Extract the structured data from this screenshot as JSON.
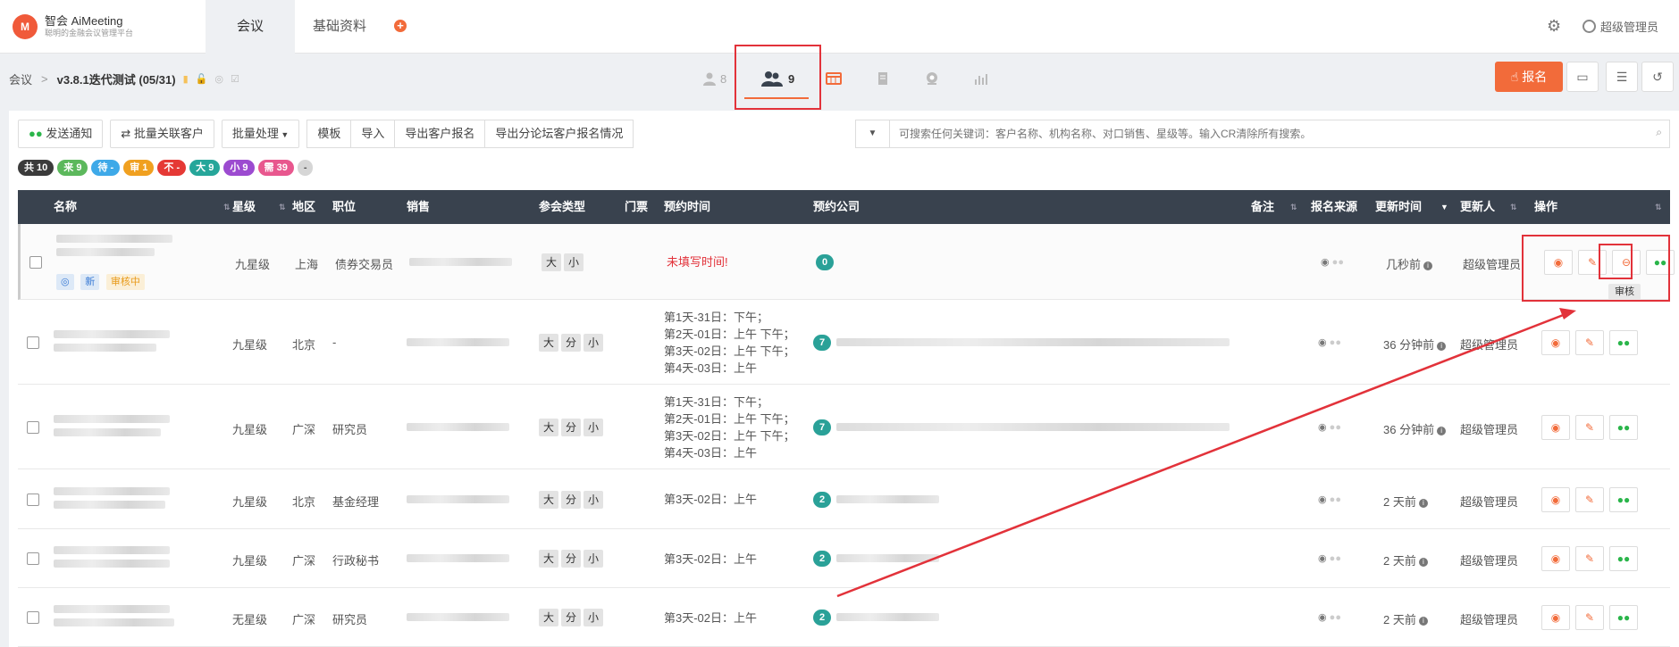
{
  "app": {
    "logo_mark": "M",
    "logo_title": "智会 AiMeeting",
    "logo_sub": "聪明的金融会议管理平台"
  },
  "nav": {
    "tabs": [
      {
        "label": "会议"
      },
      {
        "label": "基础资料"
      }
    ],
    "plus": "+",
    "user": "超级管理员"
  },
  "breadcrumb": {
    "root": "会议",
    "sep": ">",
    "conference": "v3.8.1迭代测试 (05/31)"
  },
  "subtabs": {
    "attendees_count": "8",
    "signups_count": "9"
  },
  "header_actions": {
    "signup": "报名"
  },
  "toolbar": {
    "notify": "发送通知",
    "bulk_link": "批量关联客户",
    "bulk_process": "批量处理",
    "template": "模板",
    "import": "导入",
    "export_signups": "导出客户报名",
    "export_forum": "导出分论坛客户报名情况"
  },
  "search": {
    "placeholder": "可搜索任何关键词：客户名称、机构名称、对口销售、星级等。输入CR清除所有搜索。"
  },
  "badges": [
    {
      "label": "共 10",
      "color": "#3b3b3b"
    },
    {
      "label": "来 9",
      "color": "#5cb85c"
    },
    {
      "label": "待 -",
      "color": "#3ea9e8"
    },
    {
      "label": "审 1",
      "color": "#f0a020"
    },
    {
      "label": "不 -",
      "color": "#e53935"
    },
    {
      "label": "大 9",
      "color": "#26a69a"
    },
    {
      "label": "小 9",
      "color": "#9c4bd0"
    },
    {
      "label": "需 39",
      "color": "#e8578e"
    },
    {
      "label": "-",
      "color": "#d6d6d6"
    }
  ],
  "table": {
    "headers": {
      "name": "名称",
      "star": "星级",
      "region": "地区",
      "position": "职位",
      "sales": "销售",
      "type": "参会类型",
      "ticket": "门票",
      "time": "预约时间",
      "company": "预约公司",
      "note": "备注",
      "source": "报名来源",
      "updated": "更新时间",
      "updater": "更新人",
      "ops": "操作"
    },
    "rows": [
      {
        "star": "九星级",
        "region": "上海",
        "position": "债券交易员",
        "tags": [
          "大",
          "小"
        ],
        "time": [
          "未填写时间!"
        ],
        "count": "0",
        "updated": "几秒前",
        "updater": "超级管理员",
        "status_new": "新",
        "status_review": "审核中"
      },
      {
        "star": "九星级",
        "region": "北京",
        "position": "-",
        "tags": [
          "大",
          "分",
          "小"
        ],
        "time": [
          "第1天-31日：下午；",
          "第2天-01日：上午 下午；",
          "第3天-02日：上午 下午；",
          "第4天-03日：上午"
        ],
        "count": "7",
        "updated": "36 分钟前",
        "updater": "超级管理员"
      },
      {
        "star": "九星级",
        "region": "广深",
        "position": "研究员",
        "tags": [
          "大",
          "分",
          "小"
        ],
        "time": [
          "第1天-31日：下午；",
          "第2天-01日：上午 下午；",
          "第3天-02日：上午 下午；",
          "第4天-03日：上午"
        ],
        "count": "7",
        "updated": "36 分钟前",
        "updater": "超级管理员"
      },
      {
        "star": "九星级",
        "region": "北京",
        "position": "基金经理",
        "tags": [
          "大",
          "分",
          "小"
        ],
        "time": [
          "第3天-02日：上午"
        ],
        "count": "2",
        "updated": "2 天前",
        "updater": "超级管理员"
      },
      {
        "star": "九星级",
        "region": "广深",
        "position": "行政秘书",
        "tags": [
          "大",
          "分",
          "小"
        ],
        "time": [
          "第3天-02日：上午"
        ],
        "count": "2",
        "updated": "2 天前",
        "updater": "超级管理员"
      },
      {
        "star": "无星级",
        "region": "广深",
        "position": "研究员",
        "tags": [
          "大",
          "分",
          "小"
        ],
        "time": [
          "第3天-02日：上午"
        ],
        "count": "2",
        "updated": "2 天前",
        "updater": "超级管理员"
      }
    ]
  },
  "tooltip": "审核"
}
